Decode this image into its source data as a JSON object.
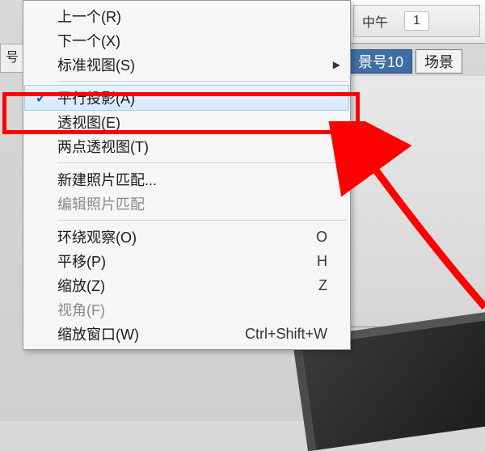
{
  "topbar": {
    "noon_label": "中午",
    "time_fragment": "1"
  },
  "tabs": {
    "scene10": "景号10",
    "scene_next": "场景"
  },
  "left_fragment": "号",
  "menu": {
    "prev": "上一个(R)",
    "next": "下一个(X)",
    "standard_views": "标准视图(S)",
    "parallel_projection": "平行投影(A)",
    "perspective": "透视图(E)",
    "two_point_perspective": "两点透视图(T)",
    "new_photo_match": "新建照片匹配...",
    "edit_photo_match": "编辑照片匹配",
    "orbit": {
      "label": "环绕观察(O)",
      "shortcut": "O"
    },
    "pan": {
      "label": "平移(P)",
      "shortcut": "H"
    },
    "zoom": {
      "label": "缩放(Z)",
      "shortcut": "Z"
    },
    "fov": "视角(F)",
    "zoom_window": {
      "label": "缩放窗口(W)",
      "shortcut": "Ctrl+Shift+W"
    }
  }
}
